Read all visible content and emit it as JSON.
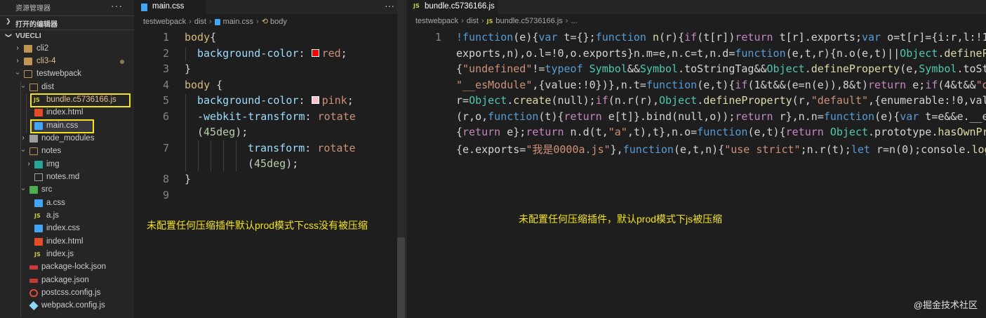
{
  "sidebar": {
    "title": "资源管理器",
    "more": "···",
    "open_editors": "打开的编辑器",
    "root": "VUECLI",
    "tree": [
      {
        "label": "cli2"
      },
      {
        "label": "cli3-4"
      },
      {
        "label": "testwebpack"
      },
      {
        "label": "dist"
      },
      {
        "label": "bundle.c5736166.js"
      },
      {
        "label": "index.html"
      },
      {
        "label": "main.css"
      },
      {
        "label": "node_modules"
      },
      {
        "label": "notes"
      },
      {
        "label": "img"
      },
      {
        "label": "notes.md"
      },
      {
        "label": "src"
      },
      {
        "label": "a.css"
      },
      {
        "label": "a.js"
      },
      {
        "label": "index.css"
      },
      {
        "label": "index.html"
      },
      {
        "label": "index.js"
      },
      {
        "label": "package-lock.json"
      },
      {
        "label": "package.json"
      },
      {
        "label": "postcss.config.js"
      },
      {
        "label": "webpack.config.js"
      }
    ]
  },
  "editor1": {
    "tab": "main.css",
    "more": "···",
    "breadcrumb": [
      "testwebpack",
      "dist",
      "main.css",
      "body"
    ],
    "line_numbers": [
      "1",
      "2",
      "3",
      "4",
      "5",
      "6",
      "7",
      "8",
      "9"
    ],
    "code": {
      "l1_sel": "body",
      "l1_punc": "{",
      "l2_prop": "background-color",
      "l2_colon": ": ",
      "l2_val": "red",
      "l2_end": ";",
      "l3": "}",
      "l4_sel": "body",
      "l4_punc": " {",
      "l5_prop": "background-color",
      "l5_colon": ": ",
      "l5_val": "pink",
      "l5_end": ";",
      "l6_prop": "-webkit-transform",
      "l6_colon": ": ",
      "l6_val": "rotate",
      "l6b_open": "(",
      "l6b_num": "45deg",
      "l6b_close": ");",
      "l7_prop": "transform",
      "l7_colon": ": ",
      "l7_val": "rotate",
      "l7b_open": "(",
      "l7b_num": "45deg",
      "l7b_close": ");",
      "l8": "}"
    },
    "annotation": "未配置任何压缩插件默认prod模式下css没有被压缩"
  },
  "editor2": {
    "tab": "bundle.c5736166.js",
    "breadcrumb": [
      "testwebpack",
      "dist",
      "bundle.c5736166.js",
      "..."
    ],
    "line_numbers": [
      "1"
    ],
    "code": [
      [
        [
          "kw",
          "!"
        ],
        [
          "kw",
          "function"
        ],
        [
          "p",
          "(e){"
        ],
        [
          "kw",
          "var"
        ],
        [
          "p",
          " t={};"
        ],
        [
          "kw",
          "function"
        ],
        [
          "p",
          " "
        ],
        [
          "fn",
          "n"
        ],
        [
          "p",
          "(r){"
        ],
        [
          "ctl",
          "if"
        ],
        [
          "p",
          "(t[r])"
        ],
        [
          "ctl",
          "return"
        ],
        [
          "p",
          " t[r].exports;"
        ],
        [
          "kw",
          "var"
        ],
        [
          "p",
          " o=t[r]={i:r,l:!1"
        ]
      ],
      [
        [
          "p",
          "exports,n),o.l=!0,o.exports}n.m=e,n.c=t,n.d="
        ],
        [
          "kw",
          "function"
        ],
        [
          "p",
          "(e,t,r){n.o(e,t)||"
        ],
        [
          "cls",
          "Object"
        ],
        [
          "p",
          "."
        ],
        [
          "fn",
          "defineP"
        ]
      ],
      [
        [
          "p",
          "{"
        ],
        [
          "str",
          "\"undefined\""
        ],
        [
          "p",
          "!="
        ],
        [
          "kw",
          "typeof"
        ],
        [
          "p",
          " "
        ],
        [
          "cls",
          "Symbol"
        ],
        [
          "p",
          "&&"
        ],
        [
          "cls",
          "Symbol"
        ],
        [
          "p",
          ".toStringTag&&"
        ],
        [
          "cls",
          "Object"
        ],
        [
          "p",
          "."
        ],
        [
          "fn",
          "defineProperty"
        ],
        [
          "p",
          "(e,"
        ],
        [
          "cls",
          "Symbol"
        ],
        [
          "p",
          ".toSt"
        ]
      ],
      [
        [
          "str",
          "\"__esModule\""
        ],
        [
          "p",
          ",{value:!0})},n.t="
        ],
        [
          "kw",
          "function"
        ],
        [
          "p",
          "(e,t){"
        ],
        [
          "ctl",
          "if"
        ],
        [
          "p",
          "(1&t&&(e=n(e)),8&t)"
        ],
        [
          "ctl",
          "return"
        ],
        [
          "p",
          " e;"
        ],
        [
          "ctl",
          "if"
        ],
        [
          "p",
          "(4&t&&"
        ],
        [
          "str",
          "\"o"
        ]
      ],
      [
        [
          "p",
          "r="
        ],
        [
          "cls",
          "Object"
        ],
        [
          "p",
          "."
        ],
        [
          "fn",
          "create"
        ],
        [
          "p",
          "(null);"
        ],
        [
          "ctl",
          "if"
        ],
        [
          "p",
          "(n.r(r),"
        ],
        [
          "cls",
          "Object"
        ],
        [
          "p",
          "."
        ],
        [
          "fn",
          "defineProperty"
        ],
        [
          "p",
          "(r,"
        ],
        [
          "str",
          "\"default\""
        ],
        [
          "p",
          ",{enumerable:!0,val"
        ]
      ],
      [
        [
          "p",
          "(r,o,"
        ],
        [
          "kw",
          "function"
        ],
        [
          "p",
          "(t){"
        ],
        [
          "ctl",
          "return"
        ],
        [
          "p",
          " e[t]}.bind(null,o));"
        ],
        [
          "ctl",
          "return"
        ],
        [
          "p",
          " r},n.n="
        ],
        [
          "kw",
          "function"
        ],
        [
          "p",
          "(e){"
        ],
        [
          "kw",
          "var"
        ],
        [
          "p",
          " t=e&&e.__e"
        ]
      ],
      [
        [
          "p",
          "{"
        ],
        [
          "ctl",
          "return"
        ],
        [
          "p",
          " e};"
        ],
        [
          "ctl",
          "return"
        ],
        [
          "p",
          " n.d(t,"
        ],
        [
          "str",
          "\"a\""
        ],
        [
          "p",
          ",t),t},n.o="
        ],
        [
          "kw",
          "function"
        ],
        [
          "p",
          "(e,t){"
        ],
        [
          "ctl",
          "return"
        ],
        [
          "p",
          " "
        ],
        [
          "cls",
          "Object"
        ],
        [
          "p",
          ".prototype."
        ],
        [
          "fn",
          "hasOwnPr"
        ]
      ],
      [
        [
          "p",
          "{e.exports="
        ],
        [
          "str",
          "\"我是0000a.js\""
        ],
        [
          "p",
          "},"
        ],
        [
          "kw",
          "function"
        ],
        [
          "p",
          "(e,t,n){"
        ],
        [
          "str",
          "\"use strict\""
        ],
        [
          "p",
          ";n.r(t);"
        ],
        [
          "kw",
          "let"
        ],
        [
          "p",
          " r=n(0);console."
        ],
        [
          "fn",
          "log"
        ]
      ]
    ],
    "annotation": "未配置任何压缩插件，默认prod模式下js被压缩"
  },
  "watermark": "@掘金技术社区",
  "colors": {
    "highlight_box": "#f5e31c",
    "annotation": "#f5e31c",
    "red_swatch": "#ff0000",
    "pink_swatch": "#ffc0cb"
  }
}
